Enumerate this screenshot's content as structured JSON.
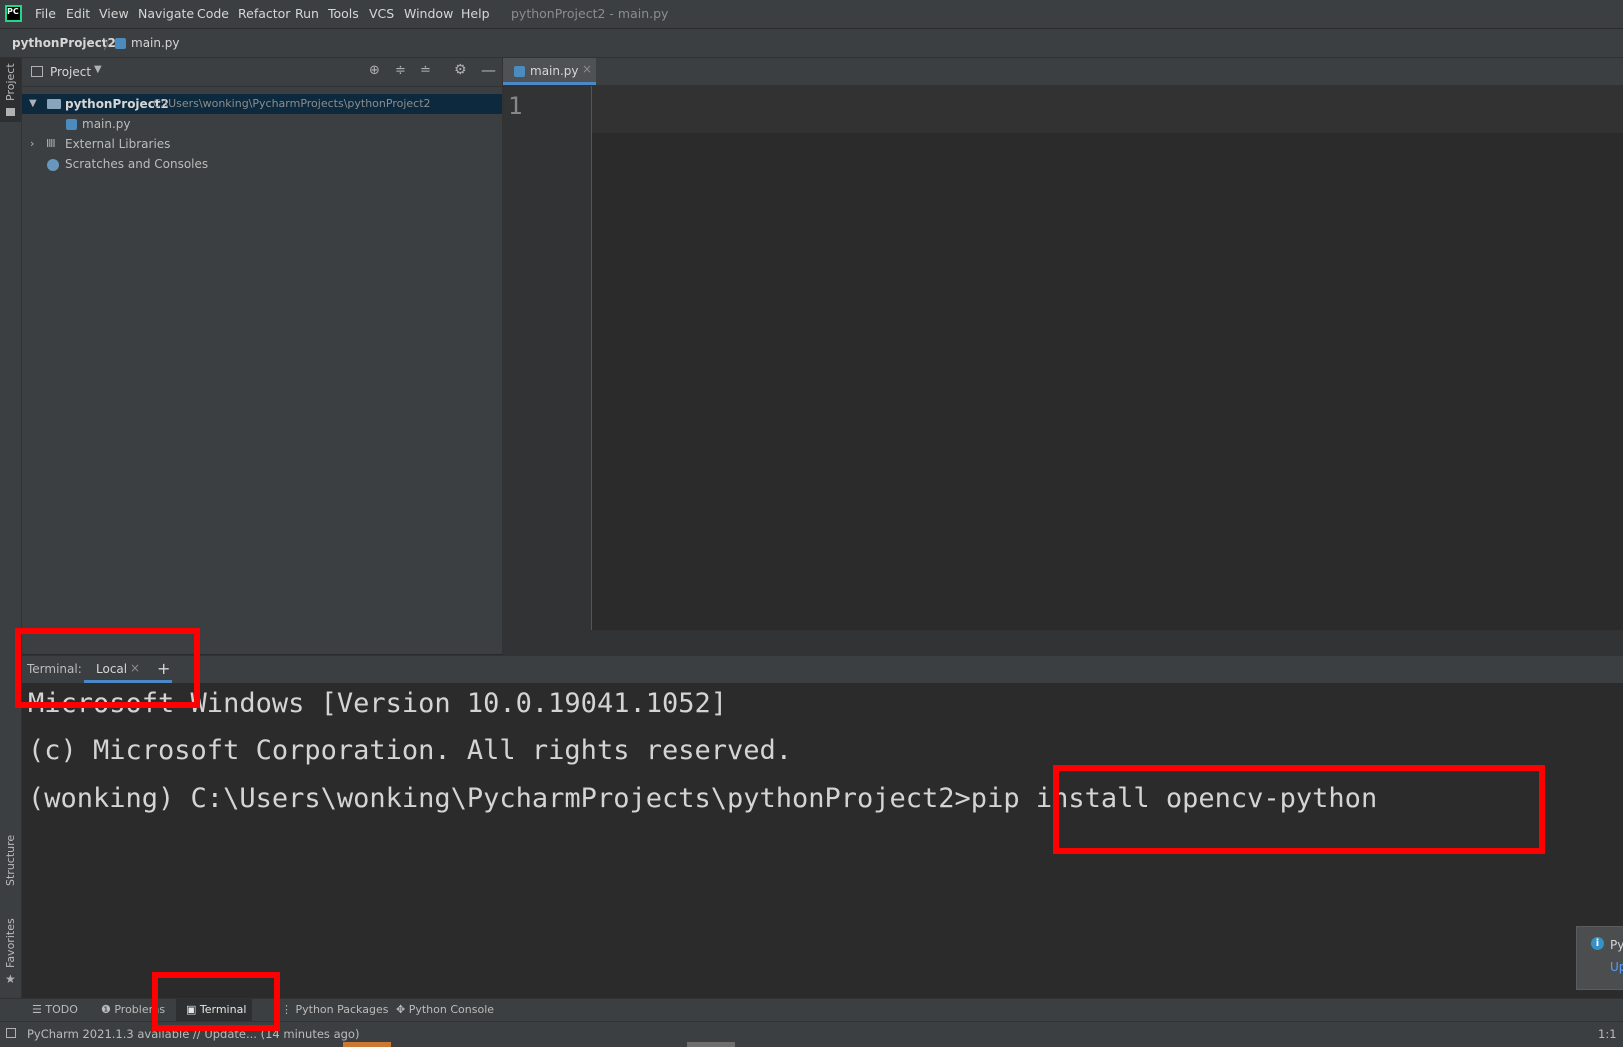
{
  "app": {
    "logo_text": "PC",
    "window_title": "pythonProject2 - main.py"
  },
  "menu": {
    "items": [
      "File",
      "Edit",
      "View",
      "Navigate",
      "Code",
      "Refactor",
      "Run",
      "Tools",
      "VCS",
      "Window",
      "Help"
    ]
  },
  "breadcrumb": {
    "project": "pythonProject2",
    "file": "main.py"
  },
  "left_stripe": {
    "project": "Project",
    "structure": "Structure",
    "favorites": "Favorites"
  },
  "project_panel": {
    "title": "Project",
    "tree": {
      "root_name": "pythonProject2",
      "root_path": "C:\\Users\\wonking\\PycharmProjects\\pythonProject2",
      "file": "main.py",
      "external_libraries": "External Libraries",
      "scratches": "Scratches and Consoles"
    }
  },
  "editor": {
    "tab_label": "main.py",
    "line_number": "1"
  },
  "terminal": {
    "label": "Terminal:",
    "tab_local": "Local",
    "add": "+",
    "lines": [
      "Microsoft Windows [Version 10.0.19041.1052]",
      "(c) Microsoft Corporation. All rights reserved.",
      "(wonking) C:\\Users\\wonking\\PycharmProjects\\pythonProject2>pip install opencv-python"
    ]
  },
  "tool_windows": {
    "todo": "TODO",
    "problems": "Problems",
    "terminal": "Terminal",
    "python_packages": "Python Packages",
    "python_console": "Python Console"
  },
  "status": {
    "message": "PyCharm 2021.1.3 available // Update... (14 minutes ago)",
    "position": "1:1"
  },
  "notification": {
    "title": "Py",
    "link": "Up"
  },
  "colors": {
    "highlight_red": "#ff0000",
    "accent_blue": "#4a88c7",
    "panel_bg": "#3c3f41",
    "editor_bg": "#2b2b2b"
  }
}
